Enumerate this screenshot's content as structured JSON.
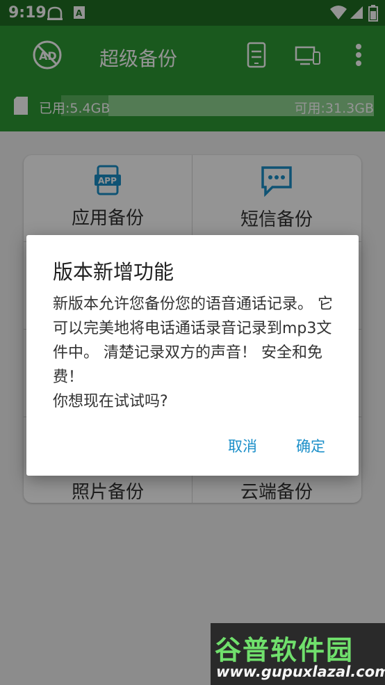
{
  "status_bar": {
    "time": "9:19"
  },
  "app_bar": {
    "title": "超级备份",
    "icons": [
      "no-ad-icon",
      "phone-transfer-icon",
      "devices-icon",
      "overflow-menu-icon"
    ]
  },
  "storage": {
    "used_label": "已用:5.4GB",
    "free_label": "可用:31.3GB",
    "used_fraction": 0.15
  },
  "grid": {
    "items": [
      {
        "label": "应用备份",
        "icon": "app-icon"
      },
      {
        "label": "短信备份",
        "icon": "sms-icon"
      },
      {
        "label": "照片备份",
        "icon": "photo-icon"
      },
      {
        "label": "云端备份",
        "icon": "cloud-icon"
      }
    ]
  },
  "dialog": {
    "title": "版本新增功能",
    "message": "新版本允许您备份您的语音通话记录。 它可以完美地将电话通话录音记录到mp3文件中。 清楚记录双方的声音！ 安全和免费！\n你想现在试试吗?",
    "cancel_label": "取消",
    "confirm_label": "确定"
  },
  "watermark": {
    "name": "谷普软件园",
    "url": "www.gupuxlazal.com"
  },
  "colors": {
    "status_bar": "#1f6e23",
    "app_bar": "#2e9a34",
    "accent_blue": "#1b8fc9"
  }
}
